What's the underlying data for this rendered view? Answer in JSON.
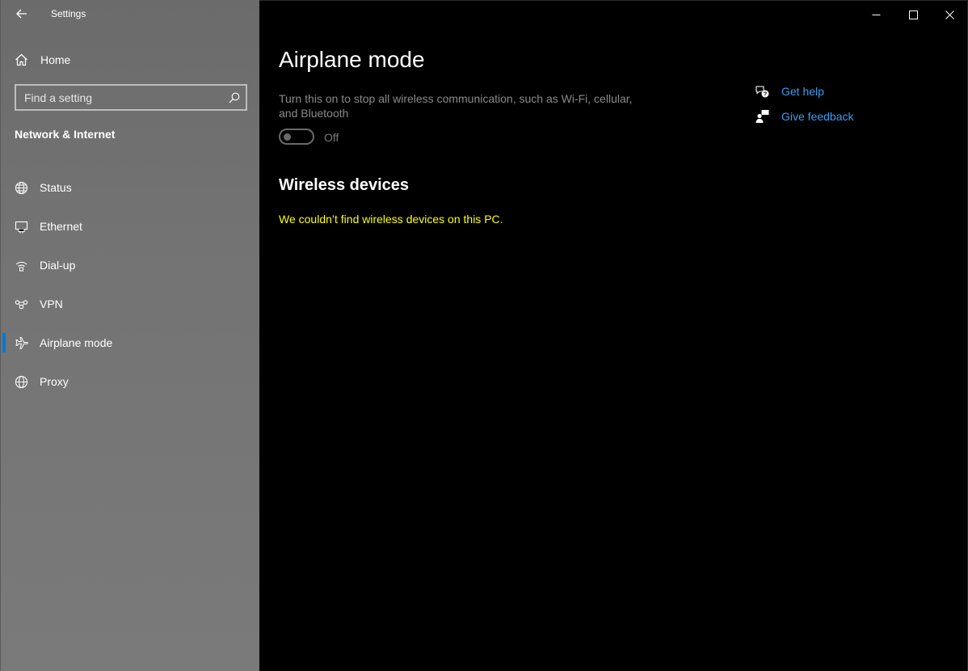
{
  "window": {
    "title": "Settings",
    "controls": {
      "minimize": "minimize",
      "maximize": "maximize",
      "close": "close"
    }
  },
  "sidebar": {
    "home_label": "Home",
    "search_placeholder": "Find a setting",
    "section_title": "Network & Internet",
    "items": [
      {
        "label": "Status",
        "icon": "globe-status-icon"
      },
      {
        "label": "Ethernet",
        "icon": "ethernet-icon"
      },
      {
        "label": "Dial-up",
        "icon": "dial-up-icon"
      },
      {
        "label": "VPN",
        "icon": "vpn-icon"
      },
      {
        "label": "Airplane mode",
        "icon": "airplane-icon",
        "active": true
      },
      {
        "label": "Proxy",
        "icon": "globe-icon"
      }
    ]
  },
  "main": {
    "title": "Airplane mode",
    "description": "Turn this on to stop all wireless communication, such as Wi-Fi, cellular, and Bluetooth",
    "toggle_state": "Off",
    "wireless_title": "Wireless devices",
    "wireless_message": "We couldn’t find wireless devices on this PC."
  },
  "help": {
    "get_help": "Get help",
    "give_feedback": "Give feedback"
  },
  "colors": {
    "accent": "#0078d7",
    "link": "#3b9cf0",
    "warning": "#ffff00"
  }
}
